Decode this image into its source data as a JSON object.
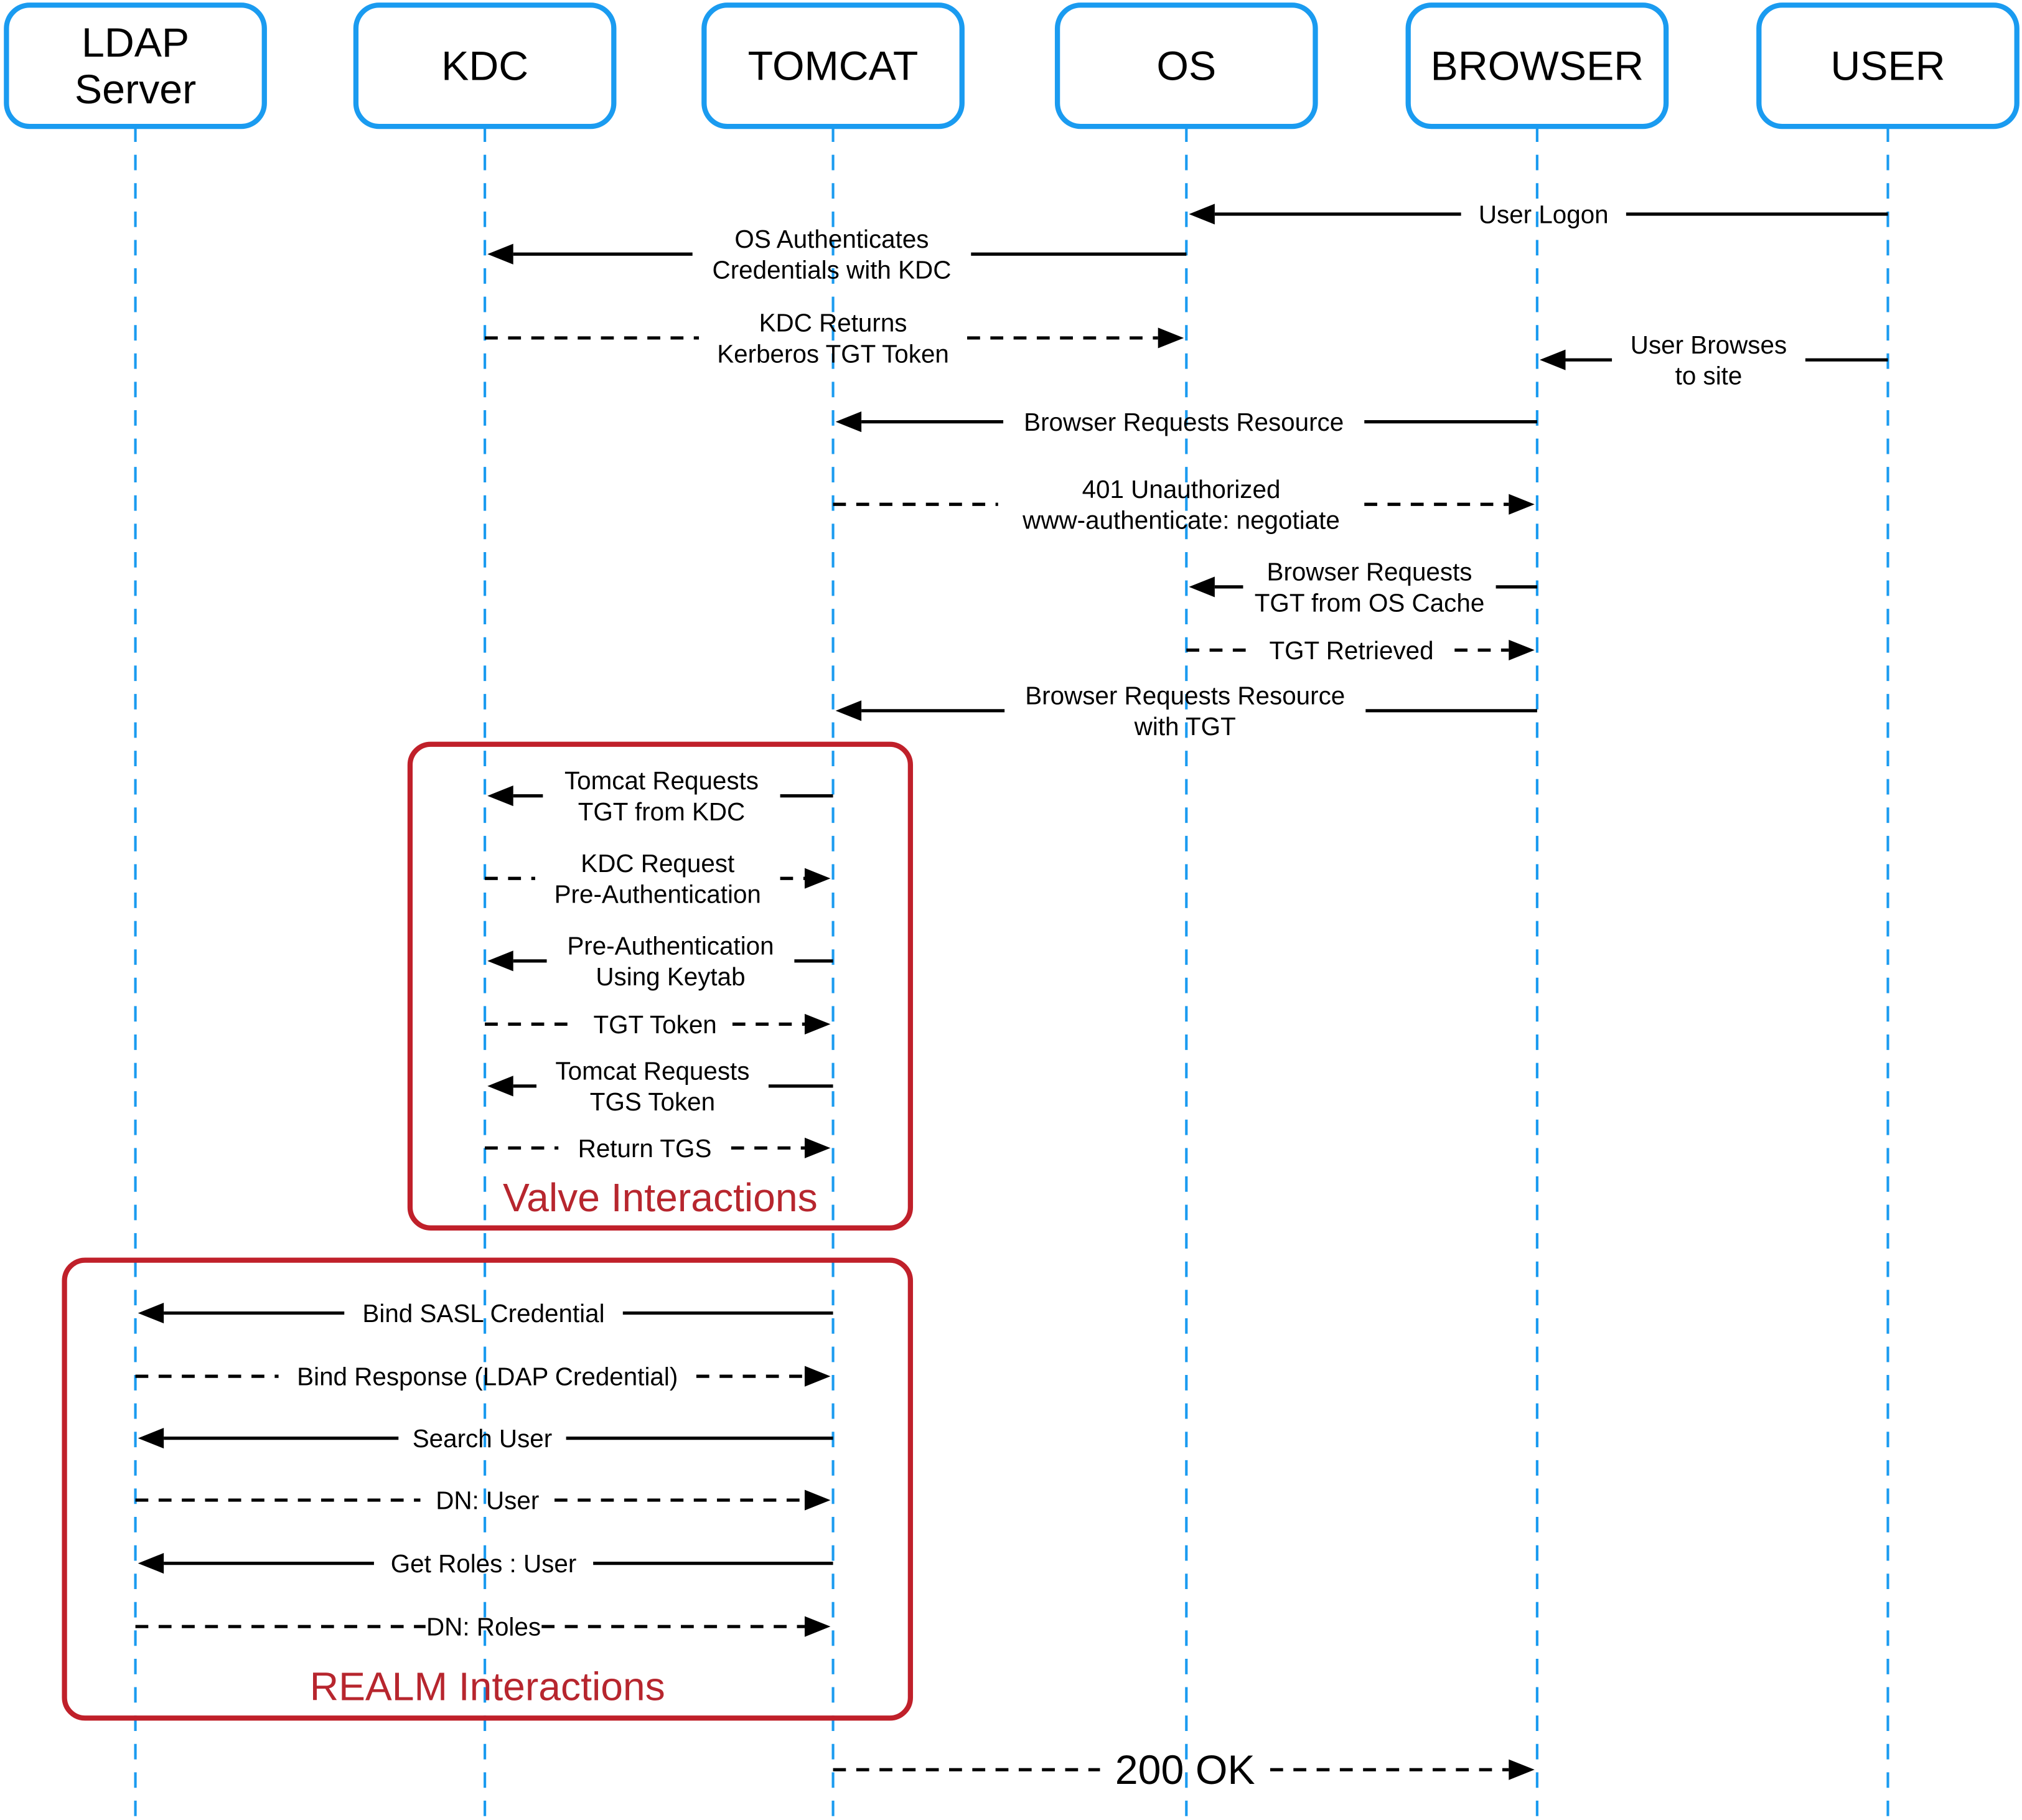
{
  "diagram": {
    "type": "sequence",
    "colors": {
      "actor_border": "#1a9bf0",
      "lifeline": "#1a9bf0",
      "group_border": "#c0202a",
      "group_label": "#b7262e",
      "message": "#000000"
    },
    "actors": [
      {
        "id": "ldap",
        "label_lines": [
          "LDAP",
          "Server"
        ]
      },
      {
        "id": "kdc",
        "label_lines": [
          "KDC"
        ]
      },
      {
        "id": "tomcat",
        "label_lines": [
          "TOMCAT"
        ]
      },
      {
        "id": "os",
        "label_lines": [
          "OS"
        ]
      },
      {
        "id": "browser",
        "label_lines": [
          "BROWSER"
        ]
      },
      {
        "id": "user",
        "label_lines": [
          "USER"
        ]
      }
    ],
    "groups": [
      {
        "id": "valve",
        "label": "Valve Interactions",
        "from": "kdc",
        "to": "tomcat",
        "messages": [
          8,
          13
        ]
      },
      {
        "id": "realm",
        "label": "REALM Interactions",
        "from": "ldap",
        "to": "tomcat",
        "messages": [
          14,
          19
        ]
      }
    ],
    "messages": [
      {
        "from": "user",
        "to": "os",
        "style": "solid",
        "label_lines": [
          "User Logon"
        ]
      },
      {
        "from": "os",
        "to": "kdc",
        "style": "solid",
        "label_lines": [
          "OS Authenticates",
          "Credentials with KDC"
        ]
      },
      {
        "from": "kdc",
        "to": "os",
        "style": "dashed",
        "label_lines": [
          "KDC Returns",
          "Kerberos TGT Token"
        ]
      },
      {
        "from": "user",
        "to": "browser",
        "style": "solid",
        "label_lines": [
          "User Browses",
          "to site"
        ]
      },
      {
        "from": "browser",
        "to": "tomcat",
        "style": "solid",
        "label_lines": [
          "Browser Requests Resource"
        ]
      },
      {
        "from": "tomcat",
        "to": "browser",
        "style": "dashed",
        "label_lines": [
          "401 Unauthorized",
          "www-authenticate: negotiate"
        ]
      },
      {
        "from": "browser",
        "to": "os",
        "style": "solid",
        "label_lines": [
          "Browser Requests",
          "TGT from OS Cache"
        ]
      },
      {
        "from": "os",
        "to": "browser",
        "style": "dashed",
        "label_lines": [
          "TGT  Retrieved"
        ]
      },
      {
        "from": "browser",
        "to": "tomcat",
        "style": "solid",
        "label_lines": [
          "Browser Requests Resource",
          "with TGT"
        ]
      },
      {
        "from": "tomcat",
        "to": "kdc",
        "style": "solid",
        "label_lines": [
          "Tomcat Requests",
          "TGT from KDC"
        ]
      },
      {
        "from": "kdc",
        "to": "tomcat",
        "style": "dashed",
        "label_lines": [
          "KDC Request",
          "Pre-Authentication"
        ]
      },
      {
        "from": "tomcat",
        "to": "kdc",
        "style": "solid",
        "label_lines": [
          "Pre-Authentication",
          "Using Keytab"
        ]
      },
      {
        "from": "kdc",
        "to": "tomcat",
        "style": "dashed",
        "label_lines": [
          "TGT Token"
        ]
      },
      {
        "from": "tomcat",
        "to": "kdc",
        "style": "solid",
        "label_lines": [
          "Tomcat Requests",
          "TGS Token"
        ]
      },
      {
        "from": "kdc",
        "to": "tomcat",
        "style": "dashed",
        "label_lines": [
          "Return TGS"
        ]
      },
      {
        "from": "tomcat",
        "to": "ldap",
        "style": "solid",
        "label_lines": [
          "Bind SASL Credential"
        ]
      },
      {
        "from": "ldap",
        "to": "tomcat",
        "style": "dashed",
        "label_lines": [
          "Bind Response (LDAP Credential)"
        ]
      },
      {
        "from": "tomcat",
        "to": "ldap",
        "style": "solid",
        "label_lines": [
          "Search User"
        ]
      },
      {
        "from": "ldap",
        "to": "tomcat",
        "style": "dashed",
        "label_lines": [
          "DN: User"
        ]
      },
      {
        "from": "tomcat",
        "to": "ldap",
        "style": "solid",
        "label_lines": [
          "Get Roles : User"
        ]
      },
      {
        "from": "ldap",
        "to": "tomcat",
        "style": "dashed",
        "label_lines": [
          "DN: Roles"
        ]
      },
      {
        "from": "tomcat",
        "to": "browser",
        "style": "dashed",
        "label_lines": [
          "200 OK"
        ],
        "emphasis": "large"
      }
    ]
  }
}
